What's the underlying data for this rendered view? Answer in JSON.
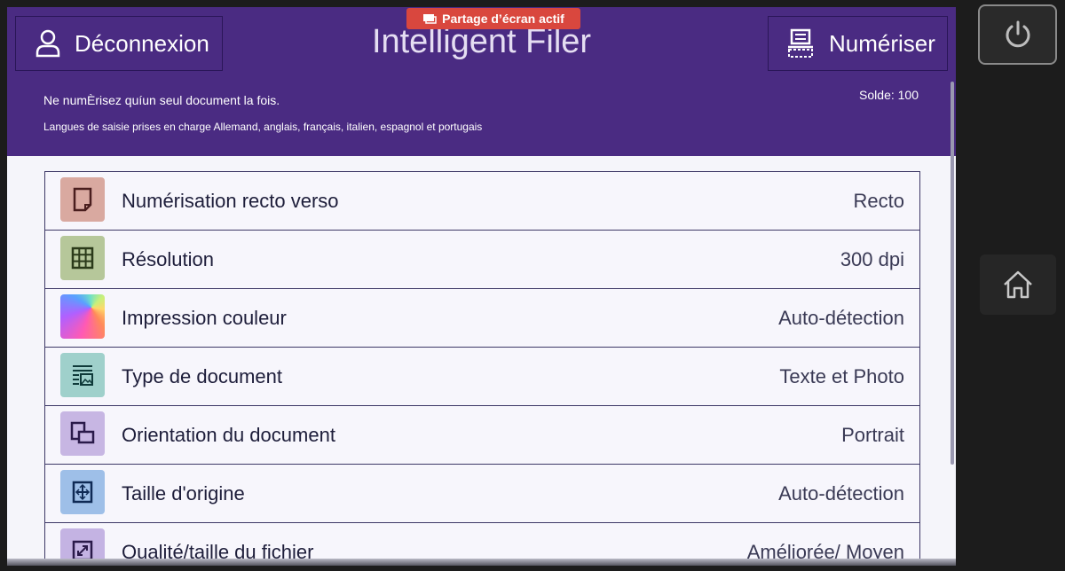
{
  "header": {
    "logout_label": "Déconnexion",
    "title": "Intelligent Filer",
    "scan_label": "Numériser",
    "share_badge": "Partage d’écran actif",
    "info_line1": "Ne numÈrisez quíun seul document la fois.",
    "info_line2": "Langues de saisie prises en charge Allemand, anglais, français, italien, espagnol et portugais",
    "balance": "Solde: 100"
  },
  "settings": [
    {
      "label": "Numérisation recto verso",
      "value": "Recto",
      "icon": "duplex-page-icon",
      "icon_bg": "#d9a9a0"
    },
    {
      "label": "Résolution",
      "value": "300 dpi",
      "icon": "grid-resolution-icon",
      "icon_bg": "#b6c79a"
    },
    {
      "label": "Impression couleur",
      "value": "Auto-détection",
      "icon": "color-gradient-icon",
      "icon_bg": "rainbow"
    },
    {
      "label": "Type de document",
      "value": "Texte et Photo",
      "icon": "text-photo-icon",
      "icon_bg": "#9fd0cb"
    },
    {
      "label": "Orientation du document",
      "value": "Portrait",
      "icon": "orientation-icon",
      "icon_bg": "#c7b6e3"
    },
    {
      "label": "Taille d'origine",
      "value": "Auto-détection",
      "icon": "original-size-icon",
      "icon_bg": "#9ebfe8"
    },
    {
      "label": "Qualité/taille du fichier",
      "value": "Améliorée/ Moyen",
      "icon": "file-quality-icon",
      "icon_bg": "#c4b3e3"
    }
  ],
  "side": {
    "power_icon": "power-icon",
    "home_icon": "home-icon"
  }
}
